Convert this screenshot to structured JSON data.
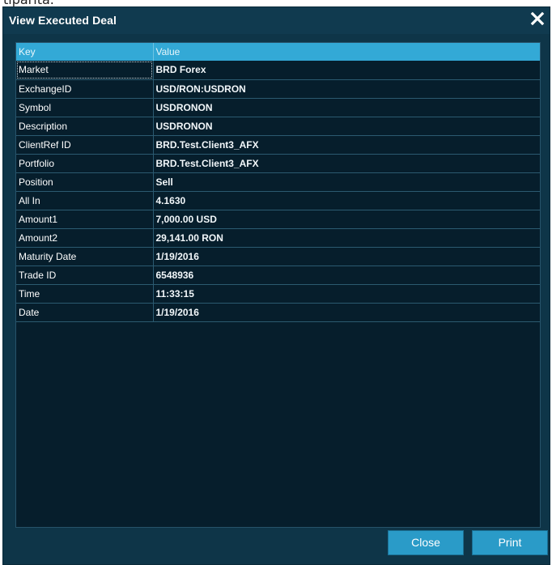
{
  "background_caption": "tipärita.",
  "dialog": {
    "title": "View Executed Deal",
    "close_icon": "close-icon"
  },
  "grid": {
    "headers": [
      "Key",
      "Value"
    ],
    "rows": [
      {
        "key": "Market",
        "value": "BRD Forex"
      },
      {
        "key": "ExchangeID",
        "value": "USD/RON:USDRON"
      },
      {
        "key": "Symbol",
        "value": "USDRONON"
      },
      {
        "key": "Description",
        "value": "USDRONON"
      },
      {
        "key": "ClientRef ID",
        "value": "BRD.Test.Client3_AFX"
      },
      {
        "key": "Portfolio",
        "value": "BRD.Test.Client3_AFX"
      },
      {
        "key": "Position",
        "value": "Sell"
      },
      {
        "key": "All In",
        "value": "4.1630"
      },
      {
        "key": "Amount1",
        "value": "7,000.00 USD"
      },
      {
        "key": "Amount2",
        "value": "29,141.00 RON"
      },
      {
        "key": "Maturity Date",
        "value": "1/19/2016"
      },
      {
        "key": "Trade ID",
        "value": "6548936"
      },
      {
        "key": "Time",
        "value": "11:33:15"
      },
      {
        "key": "Date",
        "value": "1/19/2016"
      }
    ]
  },
  "buttons": {
    "close_label": "Close",
    "print_label": "Print"
  },
  "colors": {
    "window_bg": "#0e3548",
    "grid_bg": "#061e2c",
    "header_bg": "#33a9d6",
    "button_bg": "#2a9bc8"
  }
}
